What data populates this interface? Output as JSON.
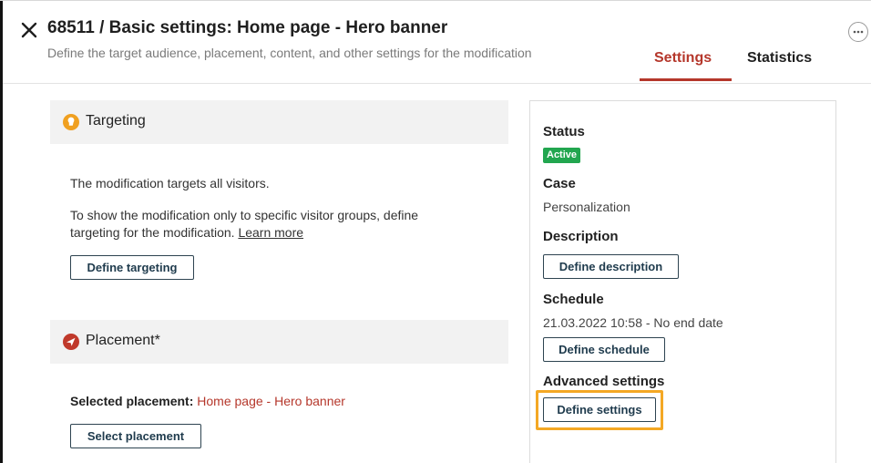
{
  "header": {
    "title": "68511 / Basic settings: Home page - Hero banner",
    "subtitle": "Define the target audience, placement, content, and other settings for the modification",
    "tabs": [
      {
        "label": "Settings",
        "active": true
      },
      {
        "label": "Statistics",
        "active": false
      }
    ]
  },
  "targeting": {
    "title": "Targeting",
    "line1": "The modification targets all visitors.",
    "line2": "To show the modification only to specific visitor groups, define",
    "line3": "targeting for the modification.",
    "learn_more": "Learn more",
    "button": "Define targeting"
  },
  "placement": {
    "title": "Placement*",
    "selected_label": "Selected placement:",
    "selected_value": "Home page - Hero banner",
    "button": "Select placement"
  },
  "side": {
    "status_label": "Status",
    "status_badge": "Active",
    "case_label": "Case",
    "case_value": "Personalization",
    "description_label": "Description",
    "description_button": "Define description",
    "schedule_label": "Schedule",
    "schedule_value": "21.03.2022 10:58 - No end date",
    "schedule_button": "Define schedule",
    "advanced_label": "Advanced settings",
    "advanced_button": "Define settings"
  },
  "colors": {
    "accent": "#b5372b",
    "active_badge": "#22a64f",
    "highlight": "#f4a824",
    "targeting_icon": "#f0a020",
    "placement_icon": "#c0392b"
  },
  "icons": [
    "close-icon",
    "more-options-icon",
    "targeting-icon",
    "placement-icon"
  ]
}
